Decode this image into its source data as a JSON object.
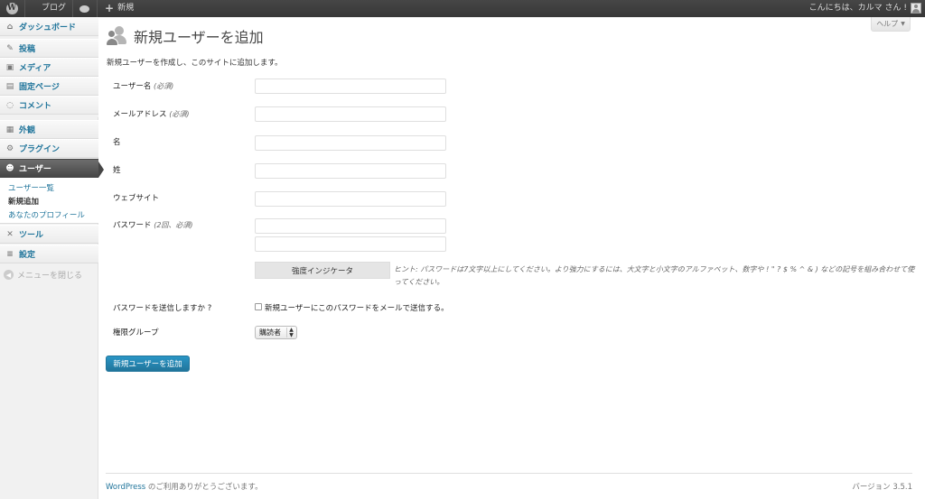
{
  "adminbar": {
    "blog_label": "ブログ",
    "new_label": "新規",
    "greeting": "こんにちは、カルマ さん !"
  },
  "menu": {
    "items": [
      {
        "label": "ダッシュボード",
        "icon": "dashboard-icon"
      },
      {
        "label": "投稿",
        "icon": "pin-icon"
      },
      {
        "label": "メディア",
        "icon": "media-icon"
      },
      {
        "label": "固定ページ",
        "icon": "page-icon"
      },
      {
        "label": "コメント",
        "icon": "comment-icon"
      },
      {
        "label": "外観",
        "icon": "appearance-icon"
      },
      {
        "label": "プラグイン",
        "icon": "plugin-icon"
      },
      {
        "label": "ユーザー",
        "icon": "users-icon"
      },
      {
        "label": "ツール",
        "icon": "tools-icon"
      },
      {
        "label": "設定",
        "icon": "settings-icon"
      }
    ],
    "submenu": [
      "ユーザー一覧",
      "新規追加",
      "あなたのプロフィール"
    ],
    "collapse_label": "メニューを閉じる"
  },
  "help_label": "ヘルプ",
  "page": {
    "title": "新規ユーザーを追加",
    "description": "新規ユーザーを作成し、このサイトに追加します。"
  },
  "form": {
    "username_label": "ユーザー名",
    "username_req": "(必須)",
    "email_label": "メールアドレス",
    "email_req": "(必須)",
    "first_name_label": "名",
    "last_name_label": "姓",
    "website_label": "ウェブサイト",
    "password_label": "パスワード",
    "password_req": "(2回、必須)",
    "strength_label": "強度インジケータ",
    "hint": "ヒント: パスワードは7文字以上にしてください。より強力にするには、大文字と小文字のアルファベット、数字や ! \" ? $ % ^ & ) などの記号を組み合わせて使ってください。",
    "send_password_label": "パスワードを送信しますか ?",
    "send_password_checkbox_label": "新規ユーザーにこのパスワードをメールで送信する。",
    "role_label": "権限グループ",
    "role_value": "購読者",
    "submit_label": "新規ユーザーを追加"
  },
  "footer": {
    "link": "WordPress",
    "text": " のご利用ありがとうございます。",
    "version": "バージョン 3.5.1"
  }
}
